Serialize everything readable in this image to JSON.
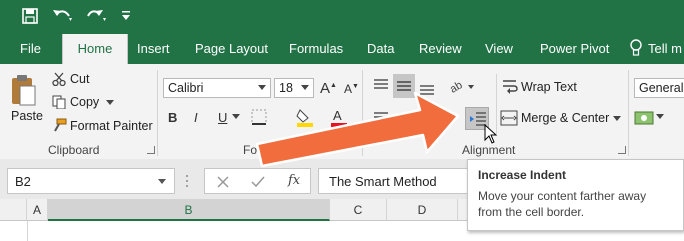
{
  "colors": {
    "brand_green": "#217346",
    "arrow_orange": "#f26d3d",
    "ribbon_bg": "#f3f3f3"
  },
  "quick_access": {
    "icons": [
      "save-icon",
      "undo-icon",
      "redo-icon",
      "customize-qat-icon"
    ]
  },
  "tabs": [
    "File",
    "Home",
    "Insert",
    "Page Layout",
    "Formulas",
    "Data",
    "Review",
    "View",
    "Power Pivot",
    "Tell m"
  ],
  "clipboard": {
    "paste": "Paste",
    "cut": "Cut",
    "copy": "Copy",
    "format_painter": "Format Painter",
    "group_label": "Clipboard"
  },
  "font": {
    "font_name": "Calibri",
    "font_size": "18",
    "bold": "B",
    "italic": "I",
    "underline": "U",
    "group_label": "Fo"
  },
  "alignment": {
    "wrap_text": "Wrap Text",
    "merge_center": "Merge & Center",
    "group_label": "Alignment"
  },
  "number": {
    "format": "General"
  },
  "formula_bar": {
    "name_box": "B2",
    "fx": "fx",
    "content": "The Smart Method"
  },
  "columns": [
    "A",
    "B",
    "C",
    "D"
  ],
  "tooltip": {
    "title": "Increase Indent",
    "body_line1": "Move your content farther away",
    "body_line2": "from the cell border."
  }
}
